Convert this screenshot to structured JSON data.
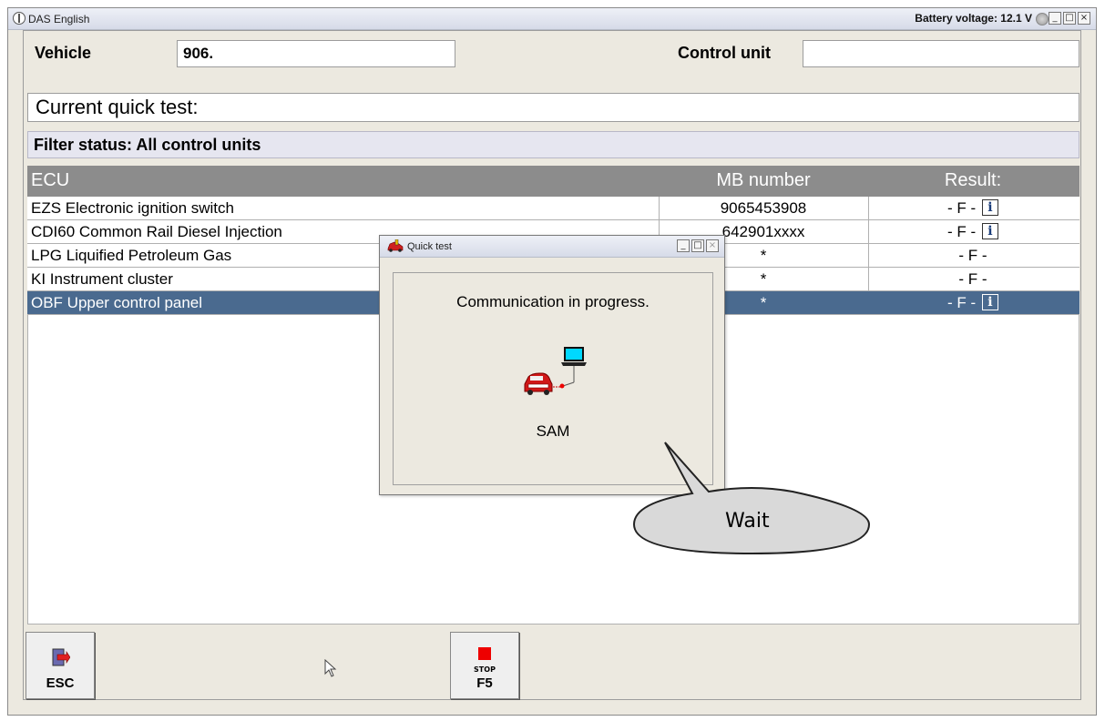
{
  "window": {
    "title": "DAS English",
    "battery_text": "Battery voltage: 12.1 V"
  },
  "header": {
    "vehicle_label": "Vehicle",
    "vehicle_value": "906.",
    "control_unit_label": "Control unit",
    "control_unit_value": ""
  },
  "quick_test_label": "Current quick test:",
  "filter_status": "Filter status: All control units",
  "table": {
    "columns": [
      "ECU",
      "MB number",
      "Result:"
    ],
    "rows": [
      {
        "ecu": "EZS Electronic ignition switch",
        "mb": "9065453908",
        "result": "- F -",
        "info": true
      },
      {
        "ecu": "CDI60 Common Rail Diesel Injection",
        "mb": "642901xxxx",
        "result": "- F -",
        "info": true
      },
      {
        "ecu": "LPG Liquified Petroleum Gas",
        "mb": "*",
        "result": "- F -",
        "info": false
      },
      {
        "ecu": "KI Instrument cluster",
        "mb": "*",
        "result": "- F -",
        "info": false
      },
      {
        "ecu": "OBF Upper control panel",
        "mb": "*",
        "result": "- F -",
        "info": true,
        "selected": true
      }
    ],
    "info_icon_text": "i"
  },
  "buttons": {
    "esc_label": "ESC",
    "f5_label": "F5",
    "stop_text": "STOP"
  },
  "dialog": {
    "title": "Quick test",
    "message": "Communication in progress.",
    "ecu_name": "SAM"
  },
  "callout": {
    "text": "Wait"
  },
  "icons": {
    "app": "mercedes-star-icon",
    "battery": "battery-status-icon",
    "esc": "exit-door-icon",
    "f5": "stop-icon",
    "dialog": "quick-test-car-icon",
    "communication": "car-laptop-link-icon"
  },
  "colors": {
    "selected_row": "#4a6a8f",
    "header_row": "#8c8c8c",
    "stop_red": "#ee0000"
  }
}
